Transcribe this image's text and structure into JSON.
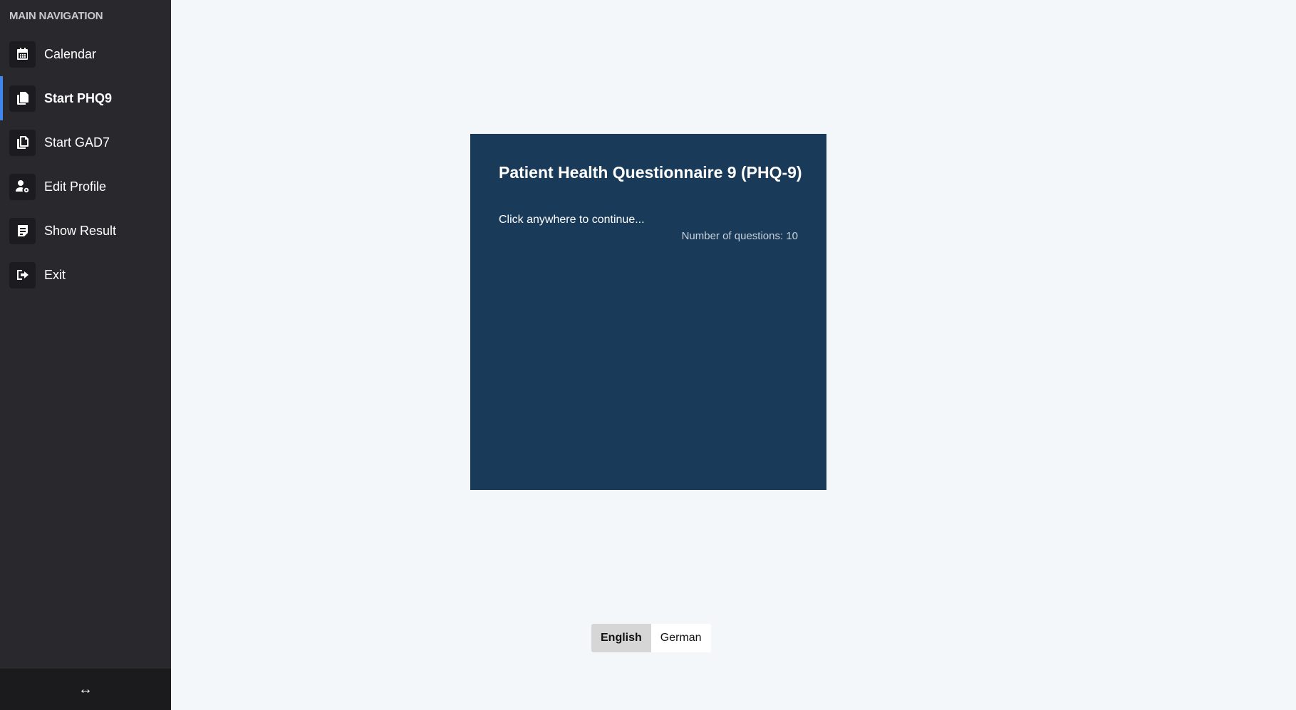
{
  "sidebar": {
    "heading": "MAIN NAVIGATION",
    "items": [
      {
        "label": "Calendar",
        "icon": "calendar-icon"
      },
      {
        "label": "Start PHQ9",
        "icon": "copy-icon",
        "active": true
      },
      {
        "label": "Start GAD7",
        "icon": "copy-outline-icon"
      },
      {
        "label": "Edit Profile",
        "icon": "user-gear-icon"
      },
      {
        "label": "Show Result",
        "icon": "document-icon"
      },
      {
        "label": "Exit",
        "icon": "sign-out-icon"
      }
    ],
    "footer_icon": "↔"
  },
  "card": {
    "title": "Patient Health Questionnaire 9 (PHQ-9)",
    "hint": "Click anywhere to continue...",
    "question_count": "Number of questions: 10"
  },
  "language": {
    "options": [
      "English",
      "German"
    ],
    "selected": "English"
  },
  "colors": {
    "sidebar_bg": "#29282d",
    "accent": "#3f86f0",
    "card_bg": "#1a3a59",
    "page_bg": "#f3f7fa"
  }
}
